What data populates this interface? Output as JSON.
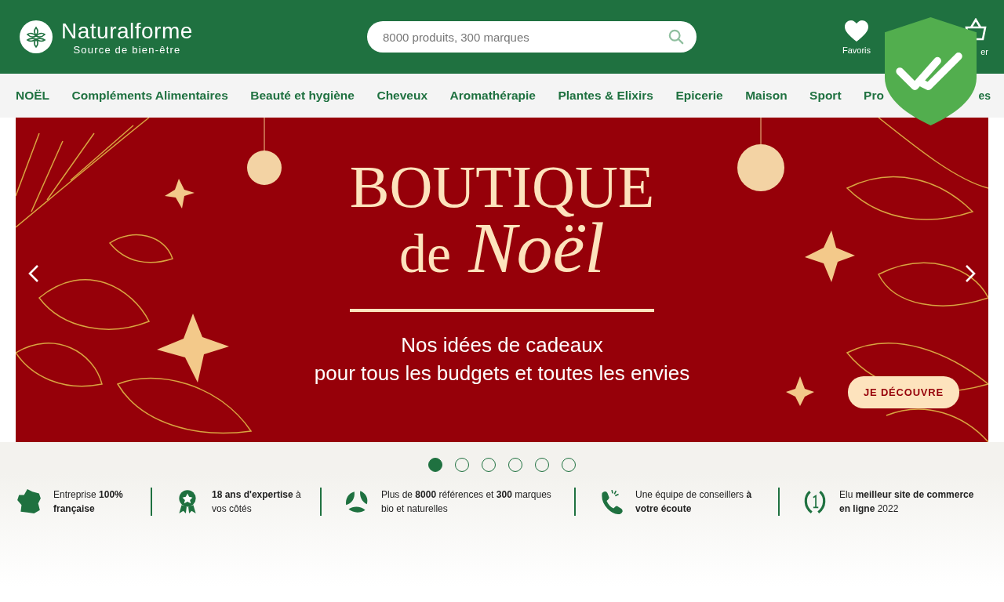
{
  "header": {
    "logo_name": "Naturalforme",
    "logo_tagline": "Source de bien-être",
    "search": {
      "placeholder": "8000 produits, 300 marques"
    },
    "actions": [
      {
        "kind": "favorites",
        "label": "Favoris"
      },
      {
        "kind": "cart",
        "label": "er"
      }
    ]
  },
  "nav": {
    "items": [
      {
        "label": "NOËL"
      },
      {
        "label": "Compléments Alimentaires"
      },
      {
        "label": "Beauté et hygiène"
      },
      {
        "label": "Cheveux"
      },
      {
        "label": "Aromathérapie"
      },
      {
        "label": "Plantes & Elixirs"
      },
      {
        "label": "Epicerie"
      },
      {
        "label": "Maison"
      },
      {
        "label": "Sport"
      },
      {
        "label": "Pro"
      }
    ],
    "tail": "es"
  },
  "banner": {
    "title": "BOUTIQUE",
    "title_line2_prefix": "de",
    "title_line2_script": "Noël",
    "subtitle_lines": [
      "Nos idées de cadeaux",
      "pour tous les budgets et toutes les envies"
    ],
    "button": "JE DÉCOUVRE"
  },
  "carousel_dots": [
    {
      "selected": true
    },
    {
      "selected": false
    },
    {
      "selected": false
    },
    {
      "selected": false
    },
    {
      "selected": false
    },
    {
      "selected": false
    }
  ],
  "features": [
    {
      "kind": "france",
      "text": "Entreprise **100%** **française**"
    },
    {
      "kind": "award",
      "text": "**18 ans d'expertise** à vos côtés"
    },
    {
      "kind": "leaves",
      "text": "Plus de **8000** références et **300** marques bio et naturelles"
    },
    {
      "kind": "phone",
      "text": "Une équipe de conseillers **à votre écoute**"
    },
    {
      "kind": "laurel",
      "text": "Elu **meilleur site de commerce en ligne** 2022"
    }
  ]
}
